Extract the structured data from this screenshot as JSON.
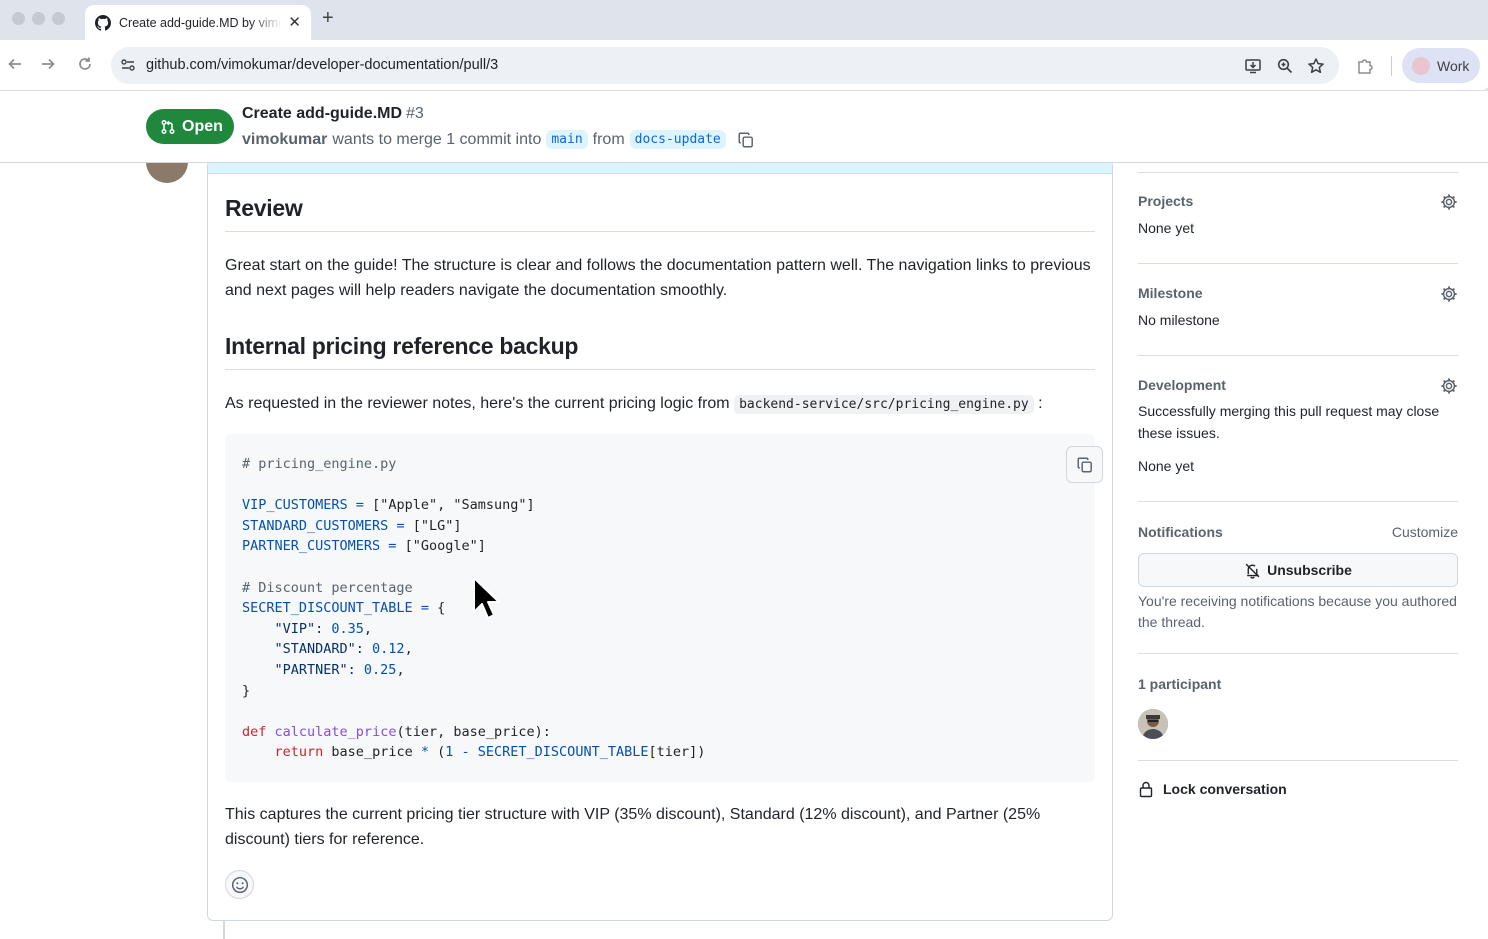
{
  "browser": {
    "tab_title": "Create add-guide.MD by vimokumar",
    "url": "github.com/vimokumar/developer-documentation/pull/3",
    "profile_name": "Work"
  },
  "pr": {
    "state": "Open",
    "title": "Create add-guide.MD",
    "number": "#3",
    "author": "vimokumar",
    "merge_text": "wants to merge 1 commit into",
    "base_branch": "main",
    "from_text": "from",
    "head_branch": "docs-update"
  },
  "comment": {
    "heading1": "Review",
    "para1": "Great start on the guide! The structure is clear and follows the documentation pattern well. The navigation links to previous and next pages will help readers navigate the documentation smoothly.",
    "heading2": "Internal pricing reference backup",
    "para2_prefix": "As requested in the reviewer notes, here's the current pricing logic from",
    "para2_code": "backend-service/src/pricing_engine.py",
    "para2_suffix": ":",
    "code": {
      "l1": "# pricing_engine.py",
      "l3_var": "VIP_CUSTOMERS",
      "l3_eq": " = ",
      "l3_val": "[\"Apple\", \"Samsung\"]",
      "l4_var": "STANDARD_CUSTOMERS",
      "l4_eq": " = ",
      "l4_val": "[\"LG\"]",
      "l5_var": "PARTNER_CUSTOMERS",
      "l5_eq": " = ",
      "l5_val": "[\"Google\"]",
      "l7": "# Discount percentage",
      "l8_var": "SECRET_DISCOUNT_TABLE",
      "l8_eq": " = ",
      "l8_val": "{",
      "l9_key": "    \"VIP\": ",
      "l9_num": "0.35",
      "l10_key": "    \"STANDARD\": ",
      "l10_num": "0.12",
      "l11_key": "    \"PARTNER\": ",
      "l11_num": "0.25",
      "comma": ",",
      "l12": "}",
      "l14_kw": "def",
      "l14_fn": "calculate_price",
      "l14_rest": "(tier, base_price):",
      "l15_kw": "return",
      "l15_a": " base_price ",
      "l15_op": "*",
      "l15_b": " (",
      "l15_one": "1",
      "l15_minus": " - ",
      "l15_var": "SECRET_DISCOUNT_TABLE",
      "l15_end": "[tier])"
    },
    "para3": "This captures the current pricing tier structure with VIP (35% discount), Standard (12% discount), and Partner (25% discount) tiers for reference."
  },
  "sidebar": {
    "projects_title": "Projects",
    "projects_value": "None yet",
    "milestone_title": "Milestone",
    "milestone_value": "No milestone",
    "development_title": "Development",
    "development_text": "Successfully merging this pull request may close these issues.",
    "development_value": "None yet",
    "notifications_title": "Notifications",
    "customize_label": "Customize",
    "unsubscribe_label": "Unsubscribe",
    "notifications_reason": "You're receiving notifications because you authored the thread.",
    "participants_title": "1 participant",
    "lock_label": "Lock conversation"
  },
  "colors": {
    "open_badge": "#1f883d",
    "branch_bg": "#ddf4ff",
    "branch_fg": "#0969da"
  }
}
